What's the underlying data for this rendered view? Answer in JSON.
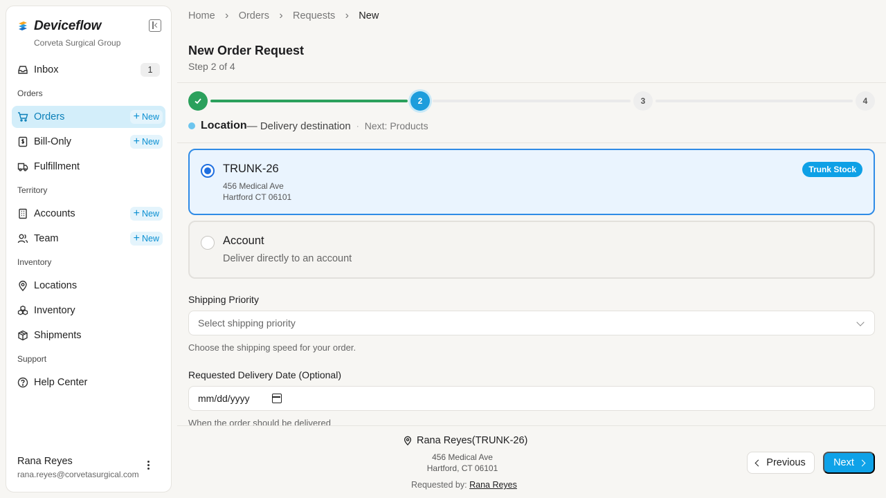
{
  "app": {
    "name": "Deviceflow",
    "org": "Corveta Surgical Group"
  },
  "sidebar": {
    "inbox": {
      "label": "Inbox",
      "count": "1"
    },
    "sections": {
      "orders": "Orders",
      "territory": "Territory",
      "inventory": "Inventory",
      "support": "Support"
    },
    "items": {
      "orders": {
        "label": "Orders",
        "new": "New",
        "active": true
      },
      "bill_only": {
        "label": "Bill-Only",
        "new": "New"
      },
      "fulfillment": {
        "label": "Fulfillment"
      },
      "accounts": {
        "label": "Accounts",
        "new": "New"
      },
      "team": {
        "label": "Team",
        "new": "New"
      },
      "locations": {
        "label": "Locations"
      },
      "inventory": {
        "label": "Inventory"
      },
      "shipments": {
        "label": "Shipments"
      },
      "help_center": {
        "label": "Help Center"
      }
    },
    "user": {
      "name": "Rana Reyes",
      "email": "rana.reyes@corvetasurgical.com"
    }
  },
  "breadcrumb": [
    "Home",
    "Orders",
    "Requests",
    "New"
  ],
  "page": {
    "title": "New Order Request",
    "step": "Step 2 of 4"
  },
  "stepper": {
    "steps": [
      "1",
      "2",
      "3",
      "4"
    ],
    "completed_steps": 1,
    "current_step": 2,
    "current_name": "Location",
    "current_desc": "— Delivery destination",
    "separator": "·",
    "next": "Next: Products"
  },
  "location_options": {
    "trunk": {
      "title": "TRUNK-26",
      "line1": "456 Medical Ave",
      "line2": "Hartford CT 06101",
      "badge": "Trunk Stock",
      "selected": true
    },
    "account": {
      "title": "Account",
      "subtitle": "Deliver directly to an account",
      "selected": false
    }
  },
  "shipping": {
    "label": "Shipping Priority",
    "placeholder": "Select shipping priority",
    "help": "Choose the shipping speed for your order."
  },
  "delivery_date": {
    "label": "Requested Delivery Date (Optional)",
    "value": "mm/dd/yyyy",
    "help": "When the order should be delivered"
  },
  "footer": {
    "name": "Rana Reyes",
    "location": "(TRUNK-26)",
    "addr1": "456 Medical Ave",
    "addr2": "Hartford, CT 06101",
    "requested_by_label": "Requested by:",
    "requested_by": "Rana Reyes",
    "previous": "Previous",
    "next": "Next"
  },
  "colors": {
    "accent": "#0fa2e8",
    "done": "#2ba05c",
    "selected_border": "#2f8be6"
  }
}
